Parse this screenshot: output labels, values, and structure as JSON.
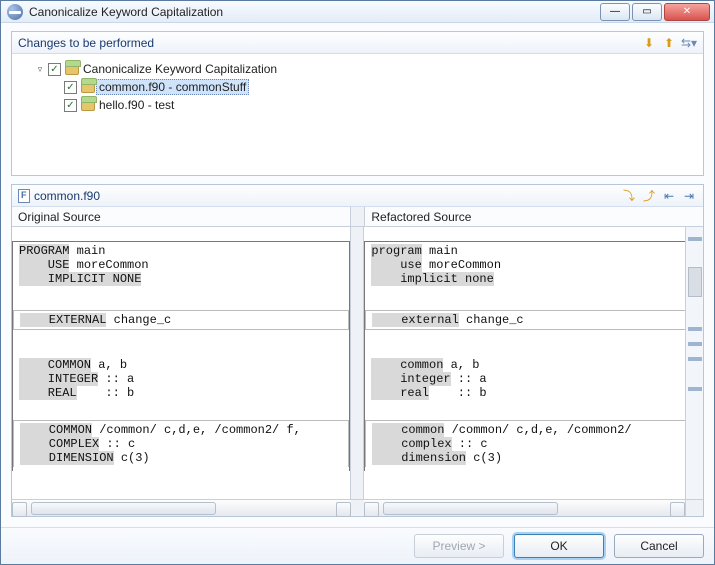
{
  "window": {
    "title": "Canonicalize Keyword Capitalization"
  },
  "changes_panel": {
    "header": "Changes to be performed",
    "root": "Canonicalize Keyword Capitalization",
    "items": [
      "common.f90 - commonStuff",
      "hello.f90 - test"
    ]
  },
  "diff": {
    "file_label": "common.f90",
    "left_header": "Original Source",
    "right_header": "Refactored Source"
  },
  "code_left": {
    "l1a": "PROGRAM",
    "l1b": " main",
    "l2a": "    USE",
    "l2b": " moreCommon",
    "l3a": "    IMPLICIT",
    "l3b": " NONE",
    "l4": "    ",
    "l5a": "    EXTERNAL",
    "l5b": " change_c",
    "l6": "    ",
    "l7a": "    COMMON",
    "l7b": " a, b",
    "l8a": "    INTEGER",
    "l8b": " :: a",
    "l9a": "    REAL",
    "l9b": "    :: b",
    "l10": "    ",
    "l11a": "    COMMON",
    "l11b": " /common/ c,d,e, /common2/ f,",
    "l12a": "    COMPLEX",
    "l12b": " :: c",
    "l13a": "    DIMENSION",
    "l13b": " c(3)"
  },
  "code_right": {
    "l1a": "program",
    "l1b": " main",
    "l2a": "    use",
    "l2b": " moreCommon",
    "l3a": "    implicit",
    "l3b": " none",
    "l4": "    ",
    "l5a": "    external",
    "l5b": " change_c",
    "l6": "    ",
    "l7a": "    common",
    "l7b": " a, b",
    "l8a": "    integer",
    "l8b": " :: a",
    "l9a": "    real",
    "l9b": "    :: b",
    "l10": "    ",
    "l11a": "    common",
    "l11b": " /common/ c,d,e, /common2/",
    "l12a": "    complex",
    "l12b": " :: c",
    "l13a": "    dimension",
    "l13b": " c(3)"
  },
  "buttons": {
    "preview": "Preview >",
    "ok": "OK",
    "cancel": "Cancel"
  }
}
